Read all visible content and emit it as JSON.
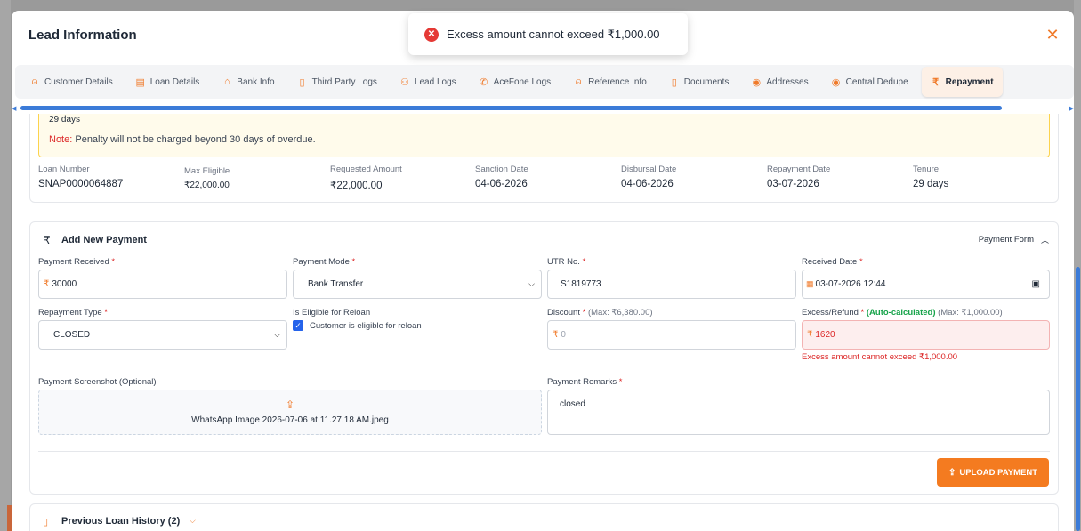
{
  "modal": {
    "title": "Lead Information",
    "close_symbol": "✕"
  },
  "toast": {
    "icon": "error-x-icon",
    "message": "Excess amount cannot exceed ₹1,000.00"
  },
  "tabs": [
    {
      "label": "Customer Details",
      "icon": "user-icon",
      "glyph": "⍝",
      "active": false
    },
    {
      "label": "Loan Details",
      "icon": "document-stack-icon",
      "glyph": "▤",
      "active": false
    },
    {
      "label": "Bank Info",
      "icon": "bank-icon",
      "glyph": "⌂",
      "active": false
    },
    {
      "label": "Third Party Logs",
      "icon": "file-text-icon",
      "glyph": "▯",
      "active": false
    },
    {
      "label": "Lead Logs",
      "icon": "users-icon",
      "glyph": "⚇",
      "active": false
    },
    {
      "label": "AceFone Logs",
      "icon": "phone-icon",
      "glyph": "✆",
      "active": false
    },
    {
      "label": "Reference Info",
      "icon": "user-plus-icon",
      "glyph": "⍝",
      "active": false
    },
    {
      "label": "Documents",
      "icon": "file-icon",
      "glyph": "▯",
      "active": false
    },
    {
      "label": "Addresses",
      "icon": "map-pin-icon",
      "glyph": "◉",
      "active": false
    },
    {
      "label": "Central Dedupe",
      "icon": "map-pin-icon",
      "glyph": "◉",
      "active": false
    },
    {
      "label": "Repayment",
      "icon": "rupee-icon",
      "glyph": "₹",
      "active": true
    }
  ],
  "penalty": {
    "days": "29 days",
    "note_label": "Note:",
    "note_text": "Penalty will not be charged beyond 30 days of overdue."
  },
  "loan_summary": [
    {
      "label": "Loan Number",
      "value": "SNAP0000064887"
    },
    {
      "label": "Max Eligible",
      "value": "₹22,000.00"
    },
    {
      "label": "Requested Amount",
      "value": "₹22,000.00"
    },
    {
      "label": "Sanction Date",
      "value": "04-06-2026"
    },
    {
      "label": "Disbursal Date",
      "value": "04-06-2026"
    },
    {
      "label": "Repayment Date",
      "value": "03-07-2026"
    },
    {
      "label": "Tenure",
      "value": "29 days"
    }
  ],
  "payment_form": {
    "title": "Add New Payment",
    "toggle_label": "Payment Form",
    "payment_received": {
      "label": "Payment Received",
      "value": "30000"
    },
    "payment_mode": {
      "label": "Payment Mode",
      "value": "Bank Transfer"
    },
    "utr": {
      "label": "UTR No.",
      "value": "S1819773"
    },
    "received_date": {
      "label": "Received Date",
      "value": "03-07-2026 12:44"
    },
    "repayment_type": {
      "label": "Repayment Type",
      "value": "CLOSED"
    },
    "reloan": {
      "label": "Is Eligible for Reloan",
      "checkbox_label": "Customer is eligible for reloan",
      "checked": true
    },
    "discount": {
      "label": "Discount",
      "max_text": "(Max: ₹6,380.00)",
      "placeholder": "0"
    },
    "excess": {
      "label": "Excess/Refund",
      "auto_text": "(Auto-calculated)",
      "max_text": "(Max: ₹1,000.00)",
      "value": "1620",
      "error": "Excess amount cannot exceed ₹1,000.00"
    },
    "screenshot": {
      "label": "Payment Screenshot (Optional)",
      "file_name": "WhatsApp Image 2026-07-06 at 11.27.18 AM.jpeg"
    },
    "remarks": {
      "label": "Payment Remarks",
      "value": "closed"
    },
    "required_mark": "*",
    "currency": "₹",
    "upload_button": "UPLOAD PAYMENT"
  },
  "history": {
    "title": "Previous Loan History (2)"
  },
  "colors": {
    "accent": "#f47b20",
    "error": "#dc2626",
    "scrollbar": "#3b7bd8",
    "success": "#16a34a"
  }
}
